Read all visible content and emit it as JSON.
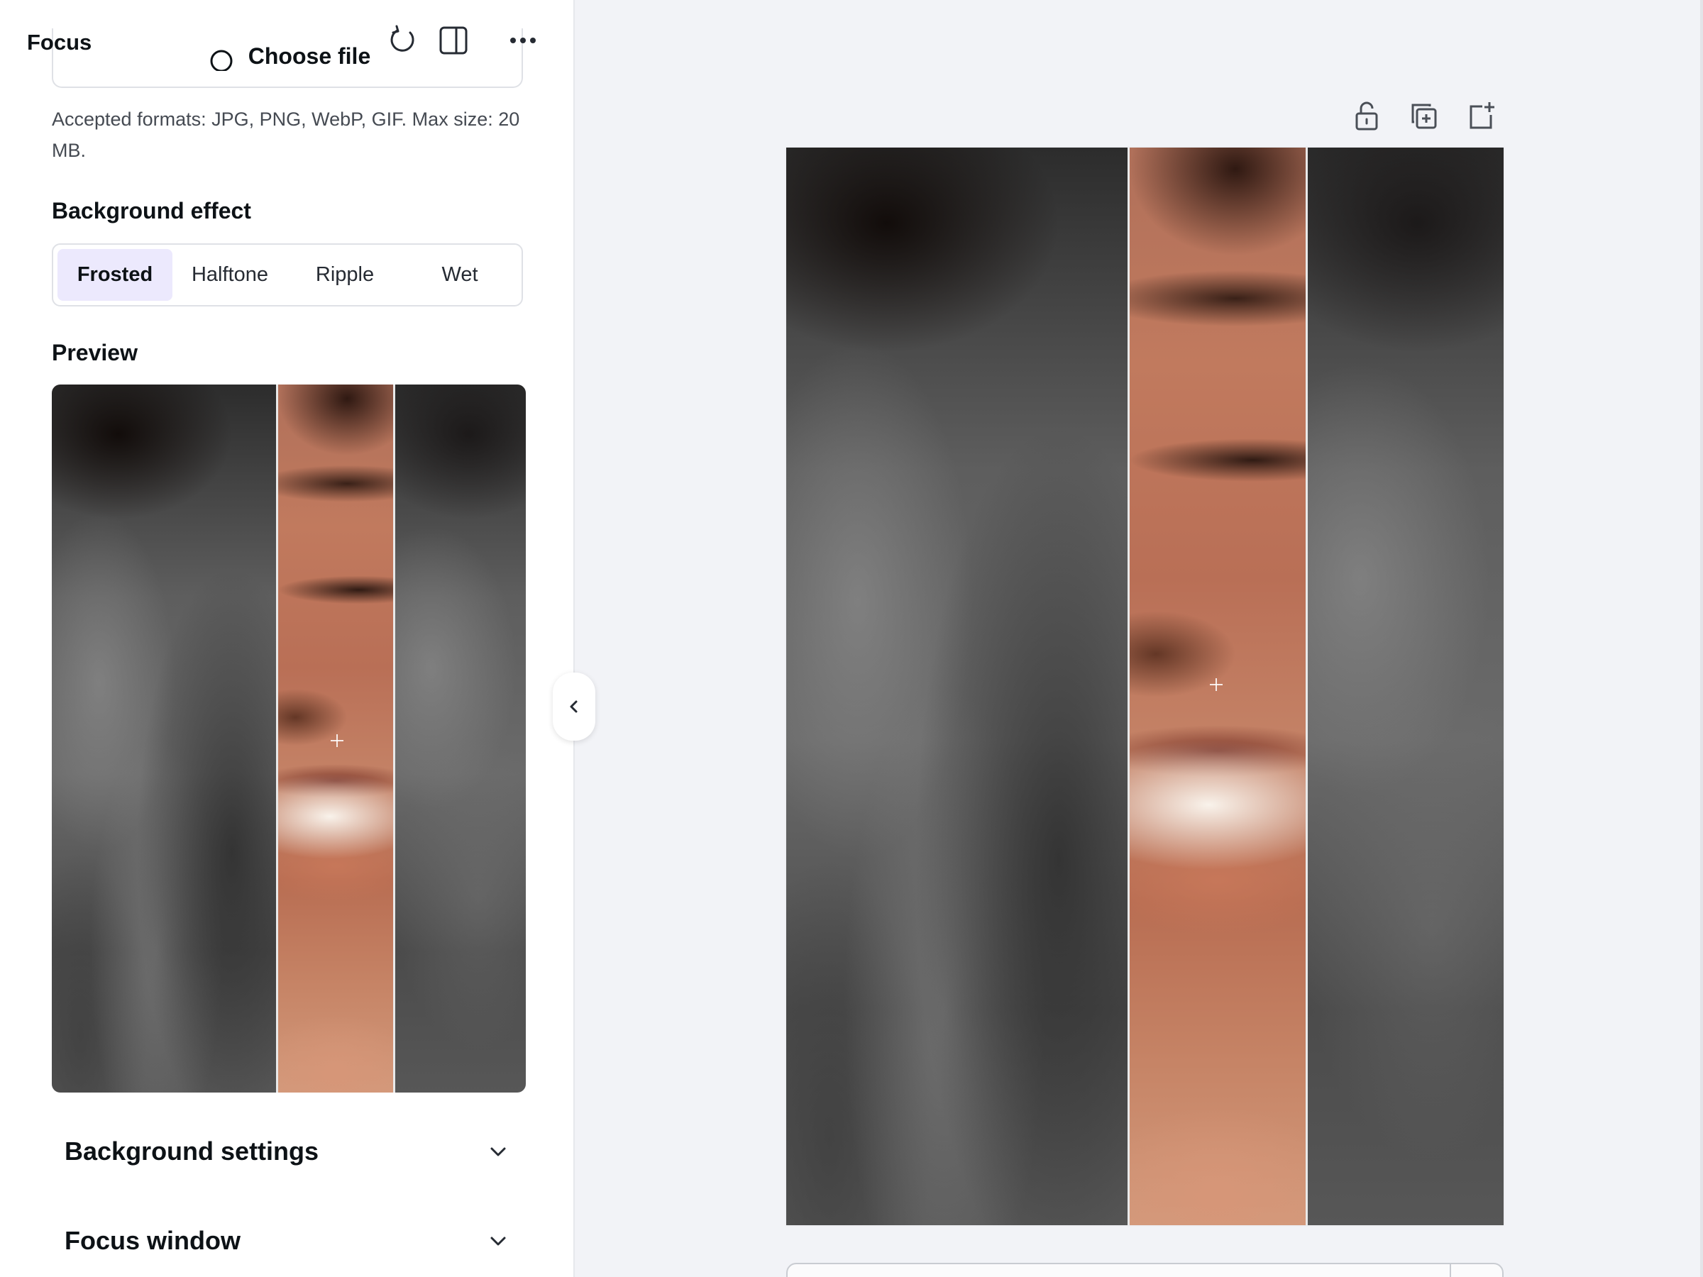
{
  "panel": {
    "title": "Focus",
    "choose_file_label": "Choose file",
    "accepted_formats": "Accepted formats: JPG, PNG, WebP, GIF. Max size: 20 MB.",
    "background_effect_label": "Background effect",
    "effects": [
      {
        "label": "Frosted",
        "selected": true
      },
      {
        "label": "Halftone",
        "selected": false
      },
      {
        "label": "Ripple",
        "selected": false
      },
      {
        "label": "Wet",
        "selected": false
      }
    ],
    "preview_label": "Preview",
    "accordions": [
      {
        "label": "Background settings",
        "expanded": false
      },
      {
        "label": "Focus window",
        "expanded": false
      }
    ]
  },
  "header_icons": [
    "refresh-icon",
    "split-panel-icon",
    "more-options-icon"
  ],
  "canvas": {
    "toolbar_icons": [
      "unlock-icon",
      "duplicate-page-icon",
      "add-page-icon"
    ]
  },
  "colors": {
    "accent_selected_bg": "#ece9fd",
    "canvas_bg": "#f2f3f7",
    "panel_bg": "#ffffff"
  }
}
